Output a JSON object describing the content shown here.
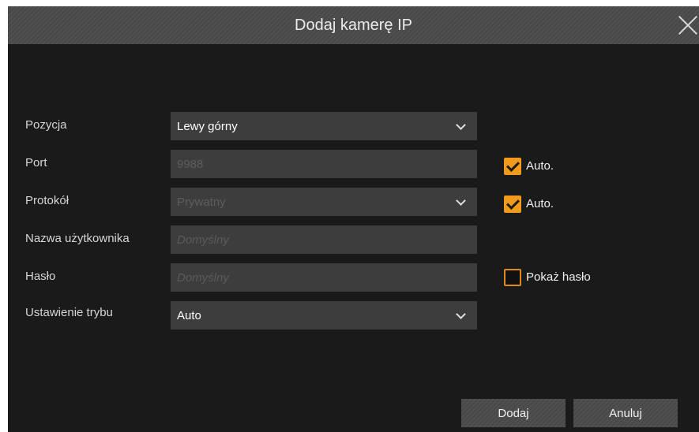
{
  "dialog": {
    "title": "Dodaj kamerę IP",
    "close_icon": "close-icon"
  },
  "form": {
    "position": {
      "label": "Pozycja",
      "value": "Lewy górny"
    },
    "port": {
      "label": "Port",
      "value": "9988",
      "auto_label": "Auto.",
      "auto_checked": true
    },
    "protocol": {
      "label": "Protokół",
      "value": "Prywatny",
      "auto_label": "Auto.",
      "auto_checked": true
    },
    "username": {
      "label": "Nazwa użytkownika",
      "placeholder": "Domyślny"
    },
    "password": {
      "label": "Hasło",
      "placeholder": "Domyślny",
      "show_label": "Pokaż hasło",
      "show_checked": false
    },
    "mode": {
      "label": "Ustawienie trybu",
      "value": "Auto"
    }
  },
  "buttons": {
    "add": "Dodaj",
    "cancel": "Anuluj"
  },
  "colors": {
    "accent": "#f29a1c",
    "background": "#1a1a1a",
    "titlebar": "#4a4a4a",
    "field": "#3d3d3d"
  }
}
